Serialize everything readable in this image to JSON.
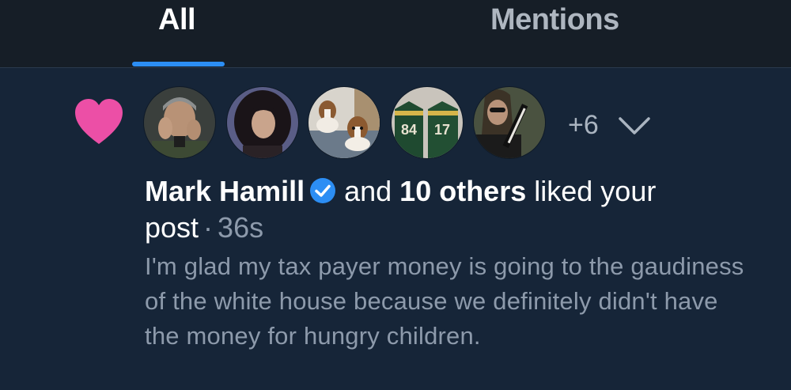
{
  "tabs": [
    {
      "label": "All",
      "selected": true
    },
    {
      "label": "Mentions",
      "selected": false
    }
  ],
  "colors": {
    "tab_indicator": "#2c8ef4",
    "heart": "#ec4fa6",
    "verified": "#2c8ef4",
    "background": "#162538",
    "tab_background": "#161e27"
  },
  "notification": {
    "type_icon": "heart-icon",
    "avatars": [
      {
        "name": "avatar-man-hand-on-face"
      },
      {
        "name": "avatar-woman-dark-hair"
      },
      {
        "name": "avatar-dogs-on-couch"
      },
      {
        "name": "avatar-green-jerseys"
      },
      {
        "name": "avatar-man-guitar"
      }
    ],
    "more_count": "+6",
    "actor_name": "Mark Hamill",
    "and_text": "and",
    "others_text": "10 others",
    "action_text": "liked your post",
    "separator": "·",
    "timestamp": "36s",
    "post_text": "I'm glad my tax payer money is going to the gaudiness of the white house because we definitely didn't have the money for hungry children."
  }
}
